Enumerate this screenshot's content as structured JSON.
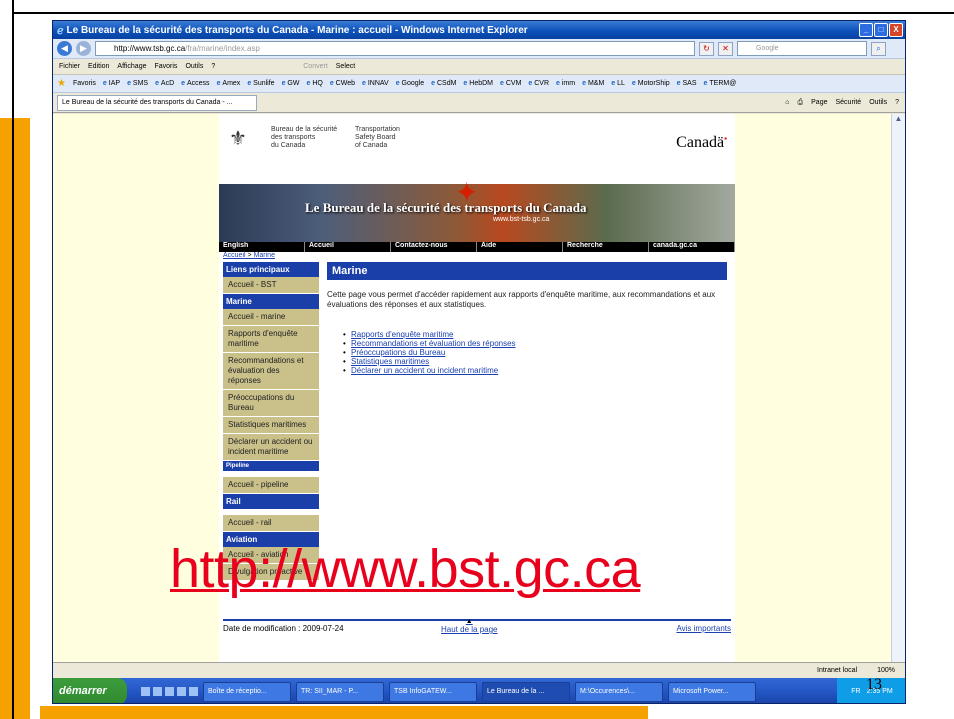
{
  "window": {
    "title": "Le Bureau de la sécurité des transports du Canada - Marine : accueil - Windows Internet Explorer",
    "controls": [
      "_",
      "□",
      "X"
    ]
  },
  "address": {
    "url_host": "http://www.tsb.gc.ca",
    "url_path": "/fra/marine/index.asp",
    "search_placeholder": "Google"
  },
  "menu": {
    "items": [
      "Fichier",
      "Edition",
      "Affichage",
      "Favoris",
      "Outils",
      "?"
    ],
    "extra": [
      "Convert",
      "Select"
    ]
  },
  "favorites": {
    "label": "Favoris",
    "items": [
      "IAP",
      "SMS",
      "AcD",
      "Access",
      "Amex",
      "Sunlife",
      "GW",
      "HQ",
      "CWeb",
      "INNAV",
      "Google",
      "CSdM",
      "HebDM",
      "CVM",
      "CVR",
      "imm",
      "M&M",
      "LL",
      "MotorShip",
      "SAS",
      "TERM@"
    ]
  },
  "tab": {
    "label": "Le Bureau de la sécurité des transports du Canada - ...",
    "commands": [
      "Page",
      "Sécurité",
      "Outils"
    ]
  },
  "site": {
    "dept_fr": "Bureau de la sécurité\ndes transports\ndu Canada",
    "dept_en": "Transportation\nSafety Board\nof Canada",
    "wordmark": "Canadä",
    "banner_title": "Le Bureau de la sécurité des transports du Canada",
    "banner_sub": "www.bst-tsb.gc.ca",
    "nav": [
      "English",
      "Accueil",
      "Contactez-nous",
      "Aide",
      "Recherche",
      "canada.gc.ca"
    ],
    "breadcrumb": [
      "Accueil",
      "Marine"
    ]
  },
  "leftnav": {
    "principaux": "Liens principaux",
    "accueil_bst": "Accueil - BST",
    "marine": "Marine",
    "marine_items": [
      "Accueil - marine",
      "Rapports d'enquête maritime",
      "Recommandations et évaluation des réponses",
      "Préoccupations du Bureau",
      "Statistiques maritimes",
      "Déclarer un accident ou incident maritime"
    ],
    "pipeline": "Pipeline",
    "pipeline_item": "Accueil - pipeline",
    "rail": "Rail",
    "rail_item": "Accueil - rail",
    "aviation": "Aviation",
    "aviation_items": [
      "Accueil - aviation",
      "Divulgation proactive"
    ]
  },
  "content": {
    "title": "Marine",
    "intro": "Cette page vous permet d'accéder rapidement aux rapports d'enquête maritime, aux recommandations et aux évaluations des réponses et aux statistiques.",
    "links": [
      "Rapports d'enquête maritime",
      "Recommandations et évaluation des réponses",
      "Préoccupations du Bureau",
      "Statistiques maritimes",
      "Déclarer un accident ou incident maritime"
    ]
  },
  "footer": {
    "date": "Date de modification : 2009-07-24",
    "top": "Haut de la page",
    "avis": "Avis importants"
  },
  "status": {
    "zone": "Intranet local",
    "zoom": "100%"
  },
  "taskbar": {
    "start": "démarrer",
    "tasks": [
      "Boîte de réceptio...",
      "TR: SII_MAR - P...",
      "TSB InfoGATEW...",
      "Le Bureau de la ...",
      "M:\\Occurences\\...",
      "Microsoft Power..."
    ],
    "lang": "FR",
    "time": "2:35 PM"
  },
  "slide": {
    "overlay_url": "http://www.bst.gc.ca",
    "page_number": "13"
  }
}
